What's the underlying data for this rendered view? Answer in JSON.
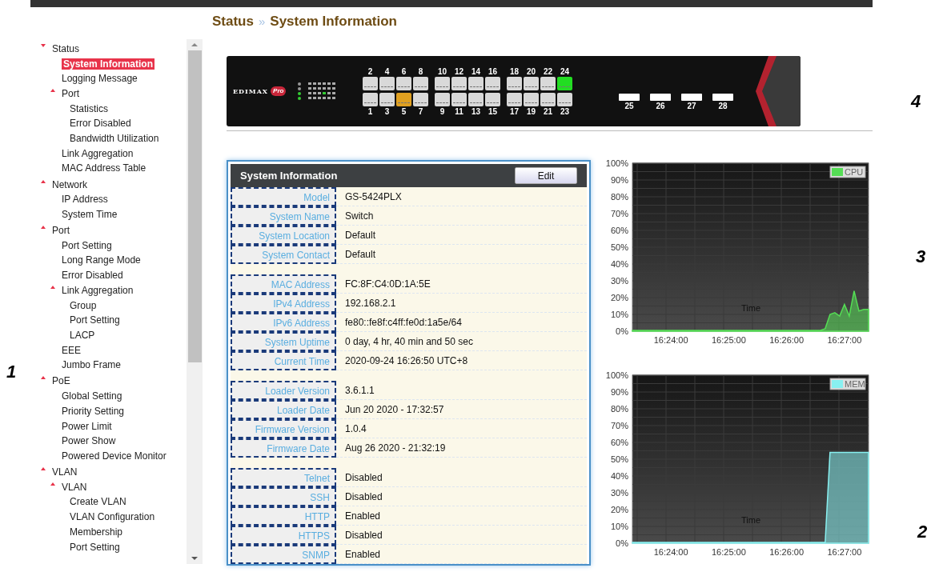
{
  "breadcrumb": {
    "section": "Status",
    "separator": "»",
    "page": "System Information"
  },
  "nav": [
    {
      "label": "Status",
      "caret_down": true,
      "selected": false,
      "children": [
        {
          "label": "System Information",
          "selected": true
        },
        {
          "label": "Logging Message",
          "selected": false
        },
        {
          "label": "Port",
          "caret_down": false,
          "selected": false,
          "children": [
            {
              "label": "Statistics",
              "selected": false
            },
            {
              "label": "Error Disabled",
              "selected": false
            },
            {
              "label": "Bandwidth Utilization",
              "selected": false
            }
          ]
        },
        {
          "label": "Link Aggregation",
          "selected": false
        },
        {
          "label": "MAC Address Table",
          "selected": false
        }
      ]
    },
    {
      "label": "Network",
      "caret_down": false,
      "selected": false,
      "children": [
        {
          "label": "IP Address",
          "selected": false
        },
        {
          "label": "System Time",
          "selected": false
        }
      ]
    },
    {
      "label": "Port",
      "caret_down": false,
      "selected": false,
      "children": [
        {
          "label": "Port Setting",
          "selected": false
        },
        {
          "label": "Long Range Mode",
          "selected": false
        },
        {
          "label": "Error Disabled",
          "selected": false
        },
        {
          "label": "Link Aggregation",
          "caret_down": false,
          "selected": false,
          "children": [
            {
              "label": "Group",
              "selected": false
            },
            {
              "label": "Port Setting",
              "selected": false
            },
            {
              "label": "LACP",
              "selected": false
            }
          ]
        },
        {
          "label": "EEE",
          "selected": false
        },
        {
          "label": "Jumbo Frame",
          "selected": false
        }
      ]
    },
    {
      "label": "PoE",
      "caret_down": false,
      "selected": false,
      "children": [
        {
          "label": "Global Setting",
          "selected": false
        },
        {
          "label": "Priority Setting",
          "selected": false
        },
        {
          "label": "Power Limit",
          "selected": false
        },
        {
          "label": "Power Show",
          "selected": false
        },
        {
          "label": "Powered Device Monitor",
          "selected": false
        }
      ]
    },
    {
      "label": "VLAN",
      "caret_down": false,
      "selected": false,
      "children": [
        {
          "label": "VLAN",
          "caret_down": false,
          "selected": false,
          "children": [
            {
              "label": "Create VLAN",
              "selected": false
            },
            {
              "label": "VLAN Configuration",
              "selected": false
            },
            {
              "label": "Membership",
              "selected": false
            },
            {
              "label": "Port Setting",
              "selected": false
            }
          ]
        }
      ]
    }
  ],
  "switch_panel": {
    "logo": "EDIMAX",
    "logo_badge": "Pro",
    "ports_top": [
      {
        "label": "2",
        "color": "#d9d9d9"
      },
      {
        "label": "4",
        "color": "#d9d9d9"
      },
      {
        "label": "6",
        "color": "#d9d9d9"
      },
      {
        "label": "8",
        "color": "#d9d9d9"
      },
      {
        "label": "10",
        "color": "#d9d9d9"
      },
      {
        "label": "12",
        "color": "#d9d9d9"
      },
      {
        "label": "14",
        "color": "#d9d9d9"
      },
      {
        "label": "16",
        "color": "#d9d9d9"
      },
      {
        "label": "18",
        "color": "#d9d9d9"
      },
      {
        "label": "20",
        "color": "#d9d9d9"
      },
      {
        "label": "22",
        "color": "#d9d9d9"
      },
      {
        "label": "24",
        "color": "#22dd22"
      }
    ],
    "ports_bottom": [
      {
        "label": "1",
        "color": "#d9d9d9"
      },
      {
        "label": "3",
        "color": "#d9d9d9"
      },
      {
        "label": "5",
        "color": "#e0a020"
      },
      {
        "label": "7",
        "color": "#d9d9d9"
      },
      {
        "label": "9",
        "color": "#d9d9d9"
      },
      {
        "label": "11",
        "color": "#d9d9d9"
      },
      {
        "label": "13",
        "color": "#d9d9d9"
      },
      {
        "label": "15",
        "color": "#d9d9d9"
      },
      {
        "label": "17",
        "color": "#d9d9d9"
      },
      {
        "label": "19",
        "color": "#d9d9d9"
      },
      {
        "label": "21",
        "color": "#d9d9d9"
      },
      {
        "label": "23",
        "color": "#d9d9d9"
      }
    ],
    "sfp_ports": [
      {
        "label": "25"
      },
      {
        "label": "26"
      },
      {
        "label": "27"
      },
      {
        "label": "28"
      }
    ]
  },
  "info_panel": {
    "title": "System Information",
    "edit_button": "Edit",
    "groups": [
      [
        {
          "label": "Model",
          "value": "GS-5424PLX"
        },
        {
          "label": "System Name",
          "value": "Switch"
        },
        {
          "label": "System Location",
          "value": "Default"
        },
        {
          "label": "System Contact",
          "value": "Default"
        }
      ],
      [
        {
          "label": "MAC Address",
          "value": "FC:8F:C4:0D:1A:5E"
        },
        {
          "label": "IPv4 Address",
          "value": "192.168.2.1"
        },
        {
          "label": "IPv6 Address",
          "value": "fe80::fe8f:c4ff:fe0d:1a5e/64"
        },
        {
          "label": "System Uptime",
          "value": "0 day, 4 hr, 40 min and 50 sec"
        },
        {
          "label": "Current Time",
          "value": "2020-09-24 16:26:50 UTC+8"
        }
      ],
      [
        {
          "label": "Loader Version",
          "value": "3.6.1.1"
        },
        {
          "label": "Loader Date",
          "value": "Jun 20 2020 - 17:32:57"
        },
        {
          "label": "Firmware Version",
          "value": "1.0.4"
        },
        {
          "label": "Firmware Date",
          "value": "Aug 26 2020 - 21:32:19"
        }
      ],
      [
        {
          "label": "Telnet",
          "value": "Disabled"
        },
        {
          "label": "SSH",
          "value": "Disabled"
        },
        {
          "label": "HTTP",
          "value": "Enabled"
        },
        {
          "label": "HTTPS",
          "value": "Disabled"
        },
        {
          "label": "SNMP",
          "value": "Enabled"
        }
      ]
    ]
  },
  "charts": [
    {
      "chart_data": {
        "type": "area",
        "xlabel": "Time",
        "grid": true,
        "ylim": [
          0,
          100
        ],
        "yticks": [
          {
            "value": 0,
            "label": "0%"
          },
          {
            "value": 10,
            "label": "10%"
          },
          {
            "value": 20,
            "label": "20%"
          },
          {
            "value": 30,
            "label": "30%"
          },
          {
            "value": 40,
            "label": "40%"
          },
          {
            "value": 50,
            "label": "50%"
          },
          {
            "value": 60,
            "label": "60%"
          },
          {
            "value": 70,
            "label": "70%"
          },
          {
            "value": 80,
            "label": "80%"
          },
          {
            "value": 90,
            "label": "90%"
          },
          {
            "value": 100,
            "label": "100%"
          }
        ],
        "categories": [
          null,
          null,
          null,
          null,
          null,
          null,
          null,
          null,
          "16:24:00",
          null,
          null,
          null,
          null,
          null,
          null,
          null,
          null,
          null,
          null,
          null,
          "16:25:00",
          null,
          null,
          null,
          null,
          null,
          null,
          null,
          null,
          null,
          null,
          null,
          "16:26:00",
          null,
          null,
          null,
          null,
          null,
          null,
          null,
          null,
          null,
          null,
          null,
          "16:27:00",
          null,
          null,
          null,
          null,
          null
        ],
        "series": [
          {
            "name": "CPU",
            "color": "#55dd55",
            "values": [
              0.5,
              0.5,
              0.5,
              0.5,
              0.5,
              0.5,
              0.5,
              0.5,
              0.5,
              0.5,
              0.5,
              0.5,
              0.5,
              0.5,
              0.5,
              0.5,
              0.5,
              0.5,
              0.5,
              0.5,
              0.5,
              0.5,
              0.5,
              0.5,
              0.5,
              0.5,
              0.5,
              0.5,
              0.5,
              0.5,
              0.5,
              0.5,
              0.5,
              0.5,
              0.5,
              0.5,
              0.5,
              0.5,
              0.5,
              0.5,
              1.5,
              10,
              11,
              9,
              16,
              9,
              24,
              12,
              13,
              13
            ]
          }
        ]
      }
    },
    {
      "chart_data": {
        "type": "area",
        "xlabel": "Time",
        "grid": true,
        "ylim": [
          0,
          100
        ],
        "yticks": [
          {
            "value": 0,
            "label": "0%"
          },
          {
            "value": 10,
            "label": "10%"
          },
          {
            "value": 20,
            "label": "20%"
          },
          {
            "value": 30,
            "label": "30%"
          },
          {
            "value": 40,
            "label": "40%"
          },
          {
            "value": 50,
            "label": "50%"
          },
          {
            "value": 60,
            "label": "60%"
          },
          {
            "value": 70,
            "label": "70%"
          },
          {
            "value": 80,
            "label": "80%"
          },
          {
            "value": 90,
            "label": "90%"
          },
          {
            "value": 100,
            "label": "100%"
          }
        ],
        "categories": [
          null,
          null,
          null,
          null,
          null,
          null,
          null,
          null,
          "16:24:00",
          null,
          null,
          null,
          null,
          null,
          null,
          null,
          null,
          null,
          null,
          null,
          "16:25:00",
          null,
          null,
          null,
          null,
          null,
          null,
          null,
          null,
          null,
          null,
          null,
          "16:26:00",
          null,
          null,
          null,
          null,
          null,
          null,
          null,
          null,
          null,
          null,
          null,
          "16:27:00",
          null,
          null,
          null,
          null,
          null
        ],
        "series": [
          {
            "name": "MEM",
            "color": "#88f0f0",
            "values": [
              0.5,
              0.5,
              0.5,
              0.5,
              0.5,
              0.5,
              0.5,
              0.5,
              0.5,
              0.5,
              0.5,
              0.5,
              0.5,
              0.5,
              0.5,
              0.5,
              0.5,
              0.5,
              0.5,
              0.5,
              0.5,
              0.5,
              0.5,
              0.5,
              0.5,
              0.5,
              0.5,
              0.5,
              0.5,
              0.5,
              0.5,
              0.5,
              0.5,
              0.5,
              0.5,
              0.5,
              0.5,
              0.5,
              0.5,
              0.5,
              0.5,
              54,
              54,
              54,
              54,
              54,
              54,
              54,
              54,
              54
            ]
          }
        ]
      }
    }
  ],
  "callouts": [
    "4",
    "3",
    "1",
    "2"
  ]
}
